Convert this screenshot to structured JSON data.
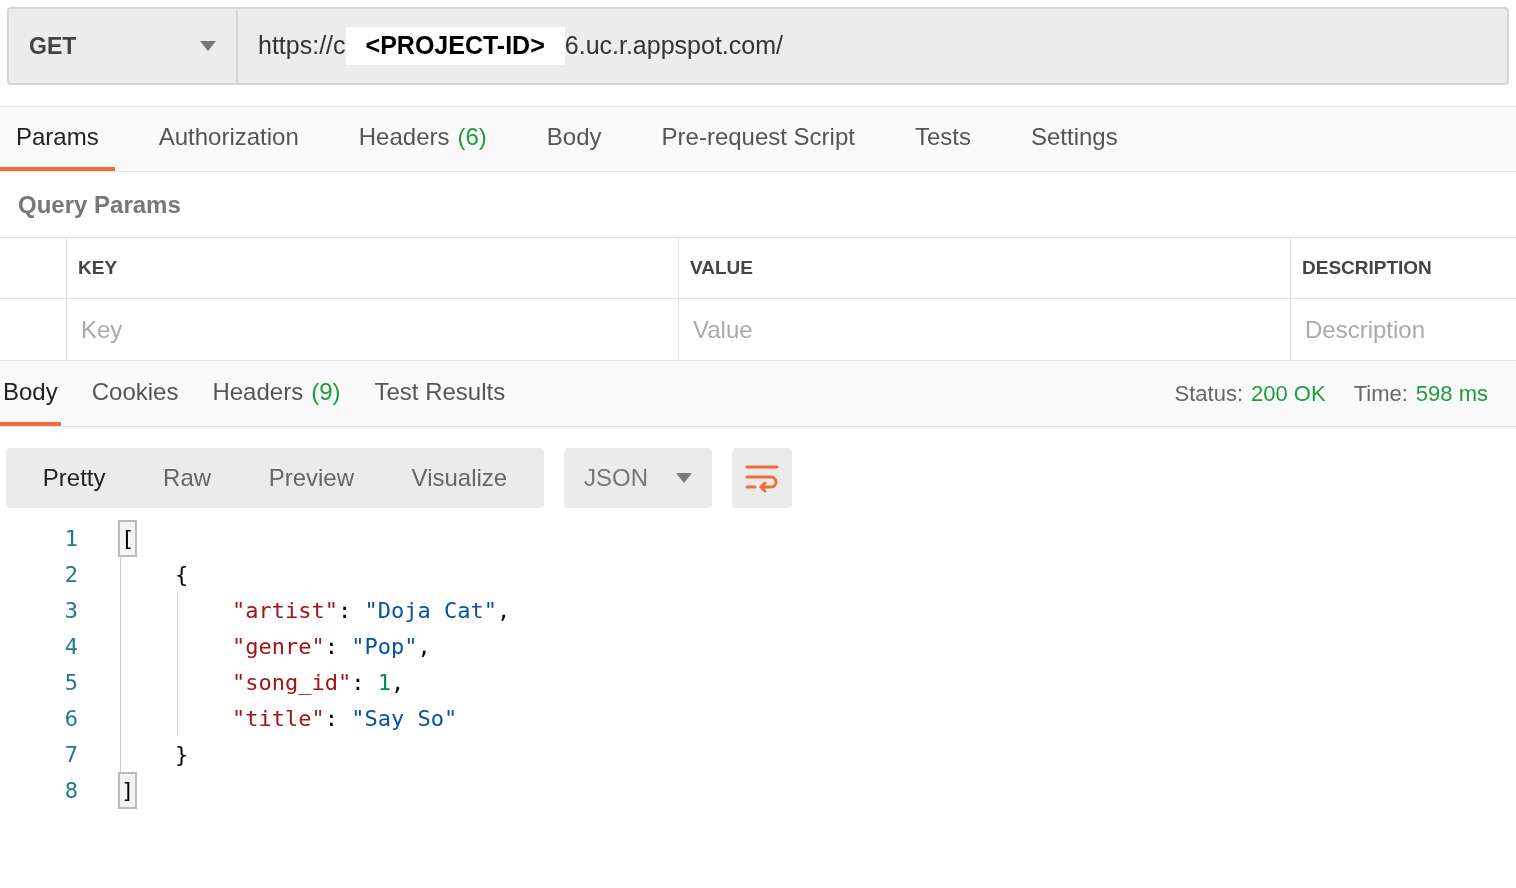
{
  "request": {
    "method": "GET",
    "url_start": "https://c",
    "redaction": "<PROJECT-ID>",
    "url_end": "6.uc.r.appspot.com/"
  },
  "request_tabs": [
    {
      "label": "Params",
      "selected": true
    },
    {
      "label": "Authorization",
      "selected": false
    },
    {
      "label": "Headers",
      "count": "(6)",
      "selected": false
    },
    {
      "label": "Body",
      "selected": false
    },
    {
      "label": "Pre-request Script",
      "selected": false
    },
    {
      "label": "Tests",
      "selected": false
    },
    {
      "label": "Settings",
      "selected": false
    }
  ],
  "query_params": {
    "title": "Query Params",
    "columns": [
      "KEY",
      "VALUE",
      "DESCRIPTION"
    ],
    "placeholders": [
      "Key",
      "Value",
      "Description"
    ]
  },
  "response_tabs": [
    {
      "label": "Body",
      "selected": true
    },
    {
      "label": "Cookies",
      "selected": false
    },
    {
      "label": "Headers",
      "count": "(9)",
      "selected": false
    },
    {
      "label": "Test Results",
      "selected": false
    }
  ],
  "response_meta": [
    {
      "label": "Status:",
      "value": "200 OK"
    },
    {
      "label": "Time:",
      "value": "598 ms"
    }
  ],
  "view_modes": [
    {
      "label": "Pretty",
      "selected": true
    },
    {
      "label": "Raw",
      "selected": false
    },
    {
      "label": "Preview",
      "selected": false
    },
    {
      "label": "Visualize",
      "selected": false
    }
  ],
  "format": "JSON",
  "code": [
    {
      "number": "1",
      "tokens": [
        {
          "kind": "punct",
          "text": "[",
          "matched": true
        }
      ],
      "children": [
        {
          "number": "2",
          "tokens": [
            {
              "kind": "punct",
              "text": "{"
            }
          ],
          "children": [
            {
              "number": "3",
              "tokens": [
                {
                  "kind": "key",
                  "text": "\"artist\""
                },
                {
                  "kind": "punct",
                  "text": ": "
                },
                {
                  "kind": "string",
                  "text": "\"Doja Cat\""
                },
                {
                  "kind": "punct",
                  "text": ","
                }
              ]
            },
            {
              "number": "4",
              "tokens": [
                {
                  "kind": "key",
                  "text": "\"genre\""
                },
                {
                  "kind": "punct",
                  "text": ": "
                },
                {
                  "kind": "string",
                  "text": "\"Pop\""
                },
                {
                  "kind": "punct",
                  "text": ","
                }
              ]
            },
            {
              "number": "5",
              "tokens": [
                {
                  "kind": "key",
                  "text": "\"song_id\""
                },
                {
                  "kind": "punct",
                  "text": ": "
                },
                {
                  "kind": "number",
                  "text": "1"
                },
                {
                  "kind": "punct",
                  "text": ","
                }
              ]
            },
            {
              "number": "6",
              "tokens": [
                {
                  "kind": "key",
                  "text": "\"title\""
                },
                {
                  "kind": "punct",
                  "text": ": "
                },
                {
                  "kind": "string",
                  "text": "\"Say So\""
                }
              ]
            }
          ]
        },
        {
          "number": "7",
          "tokens": [
            {
              "kind": "punct",
              "text": "}"
            }
          ]
        }
      ]
    },
    {
      "number": "8",
      "tokens": [
        {
          "kind": "punct",
          "text": "]",
          "matched": true
        }
      ]
    }
  ]
}
